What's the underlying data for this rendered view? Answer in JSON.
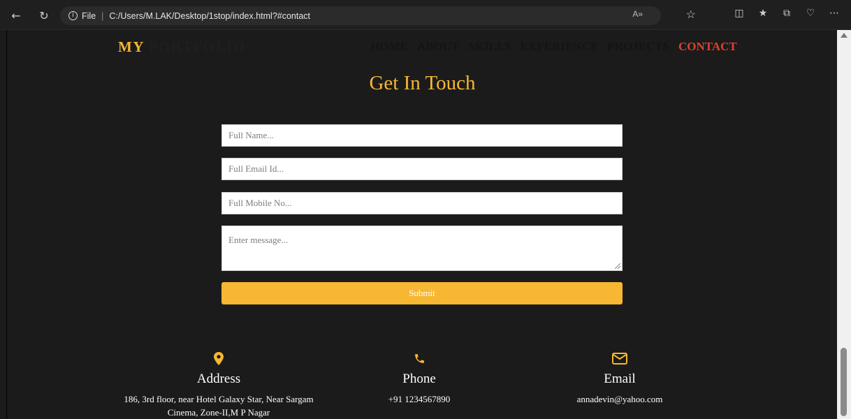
{
  "browser": {
    "file_label": "File",
    "url": "C:/Users/M.LAK/Desktop/1stop/index.html?#contact",
    "read_aloud": "A»"
  },
  "site": {
    "logo_my": "MY",
    "logo_portfolio": "PORTFOLIO",
    "nav": [
      "HOME",
      "ABOUT",
      "SKILLS",
      "EXPERIENCE",
      "PROJECTS",
      "CONTACT"
    ],
    "active_nav": "CONTACT"
  },
  "contact": {
    "title": "Get In Touch",
    "name_placeholder": "Full Name...",
    "email_placeholder": "Full Email Id...",
    "mobile_placeholder": "Full Mobile No...",
    "message_placeholder": "Enter message...",
    "submit_label": "Submit"
  },
  "info": {
    "address": {
      "heading": "Address",
      "text": "186, 3rd floor, near Hotel Galaxy Star, Near Sargam Cinema, Zone-II,M P Nagar",
      "icon": "location-pin-icon"
    },
    "phone": {
      "heading": "Phone",
      "text": "+91 1234567890",
      "icon": "phone-icon"
    },
    "email": {
      "heading": "Email",
      "text": "annadevin@yahoo.com",
      "icon": "envelope-icon"
    }
  },
  "colors": {
    "accent": "#f7b733",
    "active_nav": "#e0412a",
    "background": "#1b1b1b"
  }
}
